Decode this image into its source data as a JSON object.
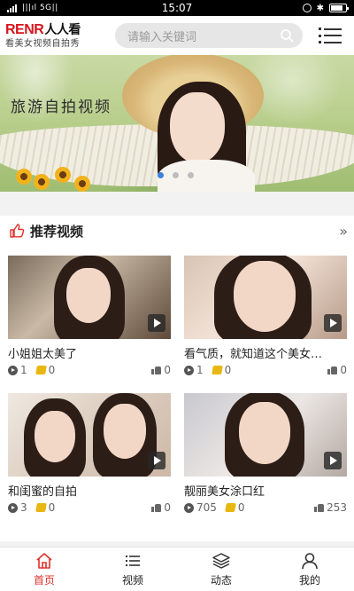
{
  "status_bar": {
    "carrier": "|||ıl 5G||",
    "time": "15:07"
  },
  "header": {
    "logo_brand": "RENR",
    "logo_cn": "人人看",
    "logo_tagline": "看美女视频自拍秀",
    "search_placeholder": "请输入关键词"
  },
  "banner": {
    "caption": "旅游自拍视频",
    "slide_count": 3,
    "active_slide": 1
  },
  "section": {
    "title": "推荐视频"
  },
  "videos": [
    {
      "title": "小姐姐太美了",
      "plays": "1",
      "coins": "0",
      "likes": "0"
    },
    {
      "title": "看气质，就知道这个美女…",
      "plays": "1",
      "coins": "0",
      "likes": "0"
    },
    {
      "title": "和闺蜜的自拍",
      "plays": "3",
      "coins": "0",
      "likes": "0"
    },
    {
      "title": "靓丽美女涂口红",
      "plays": "705",
      "coins": "0",
      "likes": "253"
    }
  ],
  "bottom_nav": [
    {
      "label": "首页",
      "icon": "home-icon",
      "active": true
    },
    {
      "label": "视频",
      "icon": "list-icon",
      "active": false
    },
    {
      "label": "动态",
      "icon": "layers-icon",
      "active": false
    },
    {
      "label": "我的",
      "icon": "user-icon",
      "active": false
    }
  ],
  "colors": {
    "accent": "#e0312b",
    "brand": "#d6151d",
    "dot_active": "#3b82e0"
  }
}
